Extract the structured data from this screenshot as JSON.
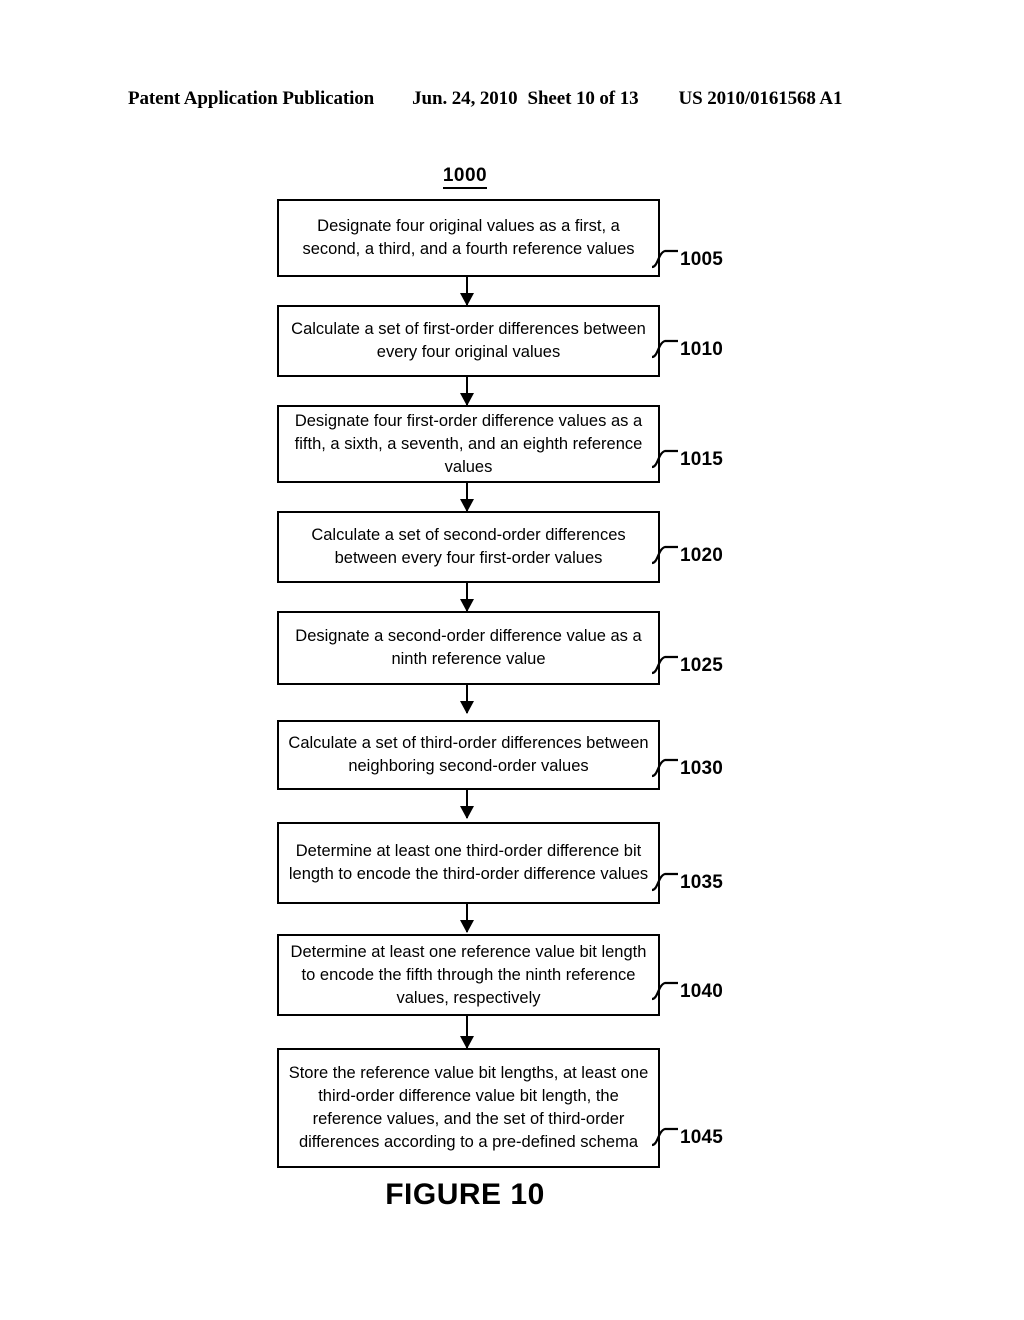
{
  "header": {
    "publication": "Patent Application Publication",
    "date": "Jun. 24, 2010",
    "sheet": "Sheet 10 of 13",
    "patent_number": "US 2010/0161568 A1"
  },
  "figure": {
    "id_label": "1000",
    "caption": "FIGURE 10",
    "steps": [
      {
        "ref": "1005",
        "text": "Designate four original values as a first, a second, a third, and a fourth reference values"
      },
      {
        "ref": "1010",
        "text": "Calculate a set of first-order differences between every four original values"
      },
      {
        "ref": "1015",
        "text": "Designate four first-order difference values as a fifth, a sixth, a seventh, and an eighth reference values"
      },
      {
        "ref": "1020",
        "text": "Calculate a set of second-order differences between every four first-order values"
      },
      {
        "ref": "1025",
        "text": "Designate a second-order difference value as a ninth reference value"
      },
      {
        "ref": "1030",
        "text": "Calculate a set of third-order differences between neighboring second-order values"
      },
      {
        "ref": "1035",
        "text": "Determine at least one third-order difference bit length to encode the third-order difference values"
      },
      {
        "ref": "1040",
        "text": "Determine at least one reference value bit length to encode the fifth through the ninth reference values, respectively"
      },
      {
        "ref": "1045",
        "text": "Store the reference value bit lengths, at least one third-order difference value bit length, the reference values, and the set of third-order differences according to a pre-defined schema"
      }
    ]
  },
  "colors": {
    "ink": "#000000",
    "paper": "#ffffff"
  }
}
